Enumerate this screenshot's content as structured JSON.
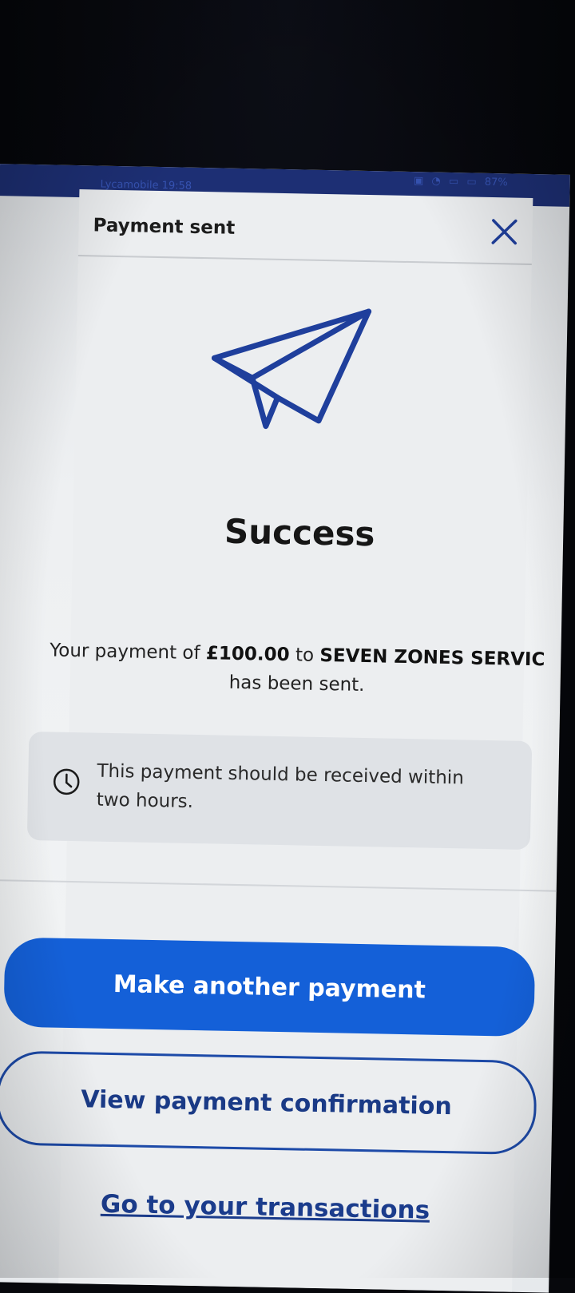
{
  "status_bar": {
    "left_text": "Lycamobile 19:58",
    "battery": "87%"
  },
  "header": {
    "title": "Payment sent",
    "close_icon": "close-icon"
  },
  "hero": {
    "icon": "paper-plane-icon",
    "icon_color": "#1f3f9c",
    "title": "Success"
  },
  "message": {
    "prefix": "Your payment of ",
    "amount": "£100.00",
    "middle": " to ",
    "payee": "SEVEN ZONES SERVIC",
    "suffix": "has been sent."
  },
  "info": {
    "icon": "clock-icon",
    "text": "This payment should be received within two hours."
  },
  "actions": {
    "primary_label": "Make another payment",
    "secondary_label": "View payment confirmation",
    "link_label": "Go to your transactions"
  },
  "colors": {
    "primary": "#1460d8",
    "outline": "#1d4aa8",
    "link": "#1b3c8c"
  }
}
